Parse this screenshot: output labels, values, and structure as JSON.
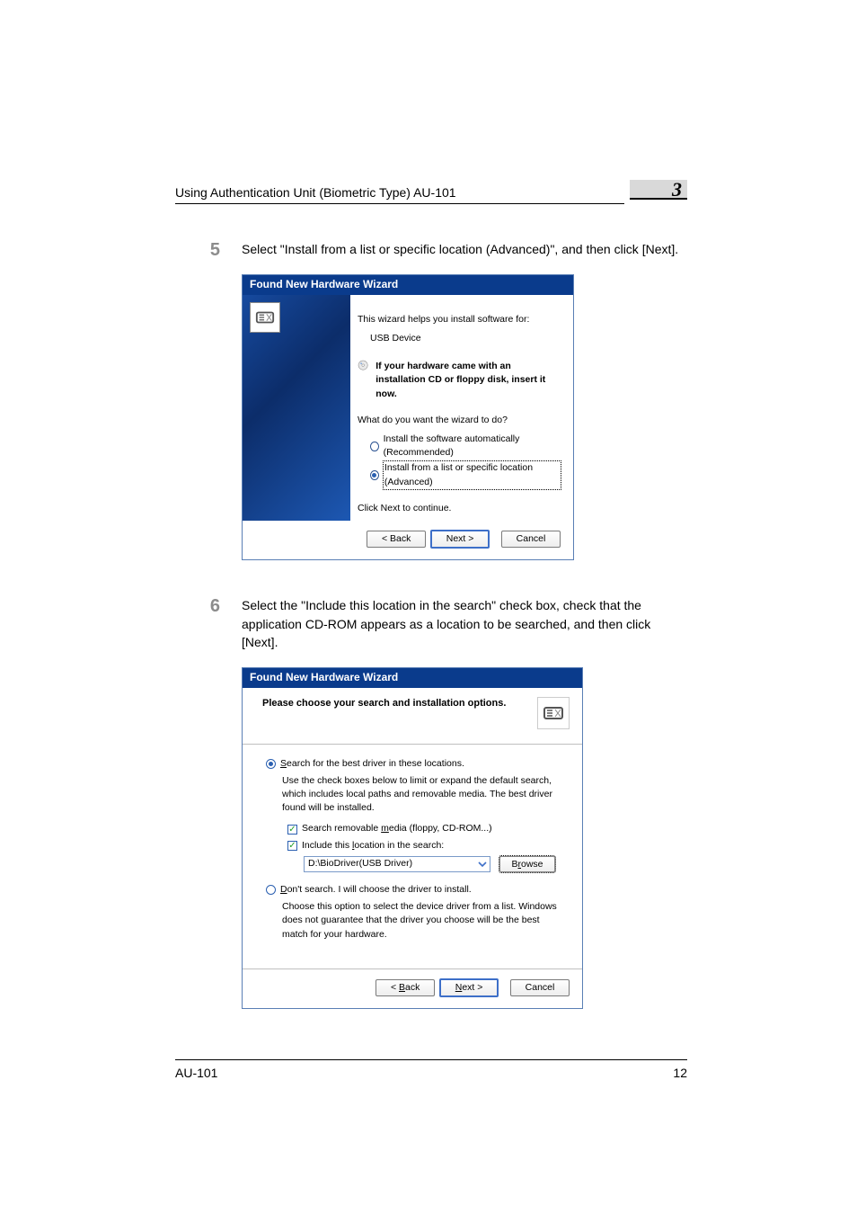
{
  "header": {
    "title": "Using Authentication Unit (Biometric Type) AU-101",
    "chapter": "3"
  },
  "steps": {
    "s5": {
      "num": "5",
      "text": "Select \"Install from a list or specific location (Advanced)\", and then click [Next]."
    },
    "s6": {
      "num": "6",
      "text": "Select the \"Include this location in the search\" check box, check that the application CD-ROM appears as a location to be searched, and then click [Next]."
    }
  },
  "wizard1": {
    "title": "Found New Hardware Wizard",
    "intro": "This wizard helps you install software for:",
    "device": "USB Device",
    "cd_notice": "If your hardware came with an installation CD or floppy disk, insert it now.",
    "question": "What do you want the wizard to do?",
    "opt_auto": "Install the software automatically (Recommended)",
    "opt_adv": "Install from a list or specific location (Advanced)",
    "cont": "Click Next to continue.",
    "back": "< Back",
    "next": "Next >",
    "cancel": "Cancel"
  },
  "wizard2": {
    "title": "Found New Hardware Wizard",
    "heading": "Please choose your search and installation options.",
    "opt_search": "Search for the best driver in these locations.",
    "opt_search_desc": "Use the check boxes below to limit or expand the default search, which includes local paths and removable media. The best driver found will be installed.",
    "chk_removable_pre": "Search removable ",
    "chk_removable_u": "m",
    "chk_removable_post": "edia (floppy, CD-ROM...)",
    "chk_include_pre": "Include this ",
    "chk_include_u": "l",
    "chk_include_post": "ocation in the search:",
    "path": "D:\\BioDriver(USB Driver)",
    "browse_pre": "B",
    "browse_u": "r",
    "browse_post": "owse",
    "opt_nosearch_pre": "",
    "opt_nosearch_u": "D",
    "opt_nosearch_post": "on't search. I will choose the driver to install.",
    "opt_nosearch_desc": "Choose this option to select the device driver from a list.  Windows does not guarantee that the driver you choose will be the best match for your hardware.",
    "back_pre": "< ",
    "back_u": "B",
    "back_post": "ack",
    "next_pre": "",
    "next_u": "N",
    "next_post": "ext >",
    "cancel": "Cancel"
  },
  "footer": {
    "left": "AU-101",
    "right": "12"
  }
}
